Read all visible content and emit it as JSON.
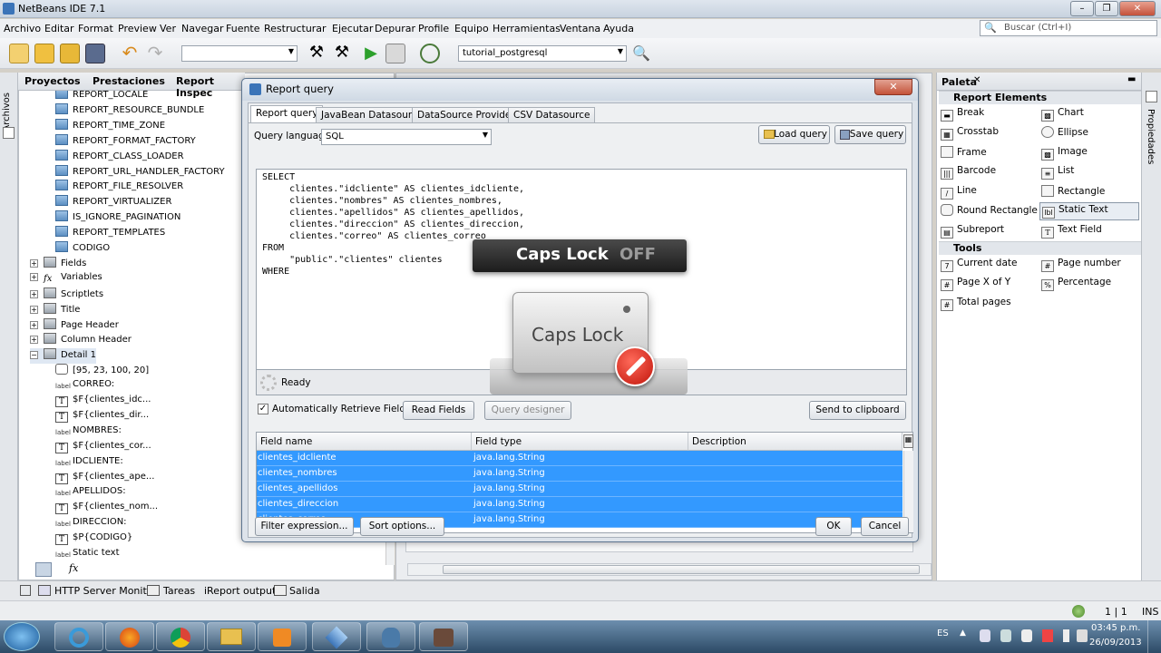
{
  "window": {
    "title": "NetBeans IDE 7.1"
  },
  "menu": [
    "Archivo",
    "Editar",
    "Format",
    "Preview",
    "Ver",
    "Navegar",
    "Fuente",
    "Restructurar",
    "Ejecutar",
    "Depurar",
    "Profile",
    "Equipo",
    "Herramientas",
    "Ventana",
    "Ayuda"
  ],
  "search": {
    "placeholder": "Buscar (Ctrl+I)"
  },
  "toolbar": {
    "project_combo": "tutorial_postgresql"
  },
  "left_tabs": [
    "Proyectos",
    "Prestaciones",
    "Report Inspec"
  ],
  "left_strip_label": "Archivos",
  "tree": [
    {
      "label": "REPORT_LOCALE",
      "icon": "parameter-icon"
    },
    {
      "label": "REPORT_RESOURCE_BUNDLE",
      "icon": "parameter-icon"
    },
    {
      "label": "REPORT_TIME_ZONE",
      "icon": "parameter-icon"
    },
    {
      "label": "REPORT_FORMAT_FACTORY",
      "icon": "parameter-icon"
    },
    {
      "label": "REPORT_CLASS_LOADER",
      "icon": "parameter-icon"
    },
    {
      "label": "REPORT_URL_HANDLER_FACTORY",
      "icon": "parameter-icon"
    },
    {
      "label": "REPORT_FILE_RESOLVER",
      "icon": "parameter-icon"
    },
    {
      "label": "REPORT_VIRTUALIZER",
      "icon": "parameter-icon"
    },
    {
      "label": "IS_IGNORE_PAGINATION",
      "icon": "parameter-icon"
    },
    {
      "label": "REPORT_TEMPLATES",
      "icon": "parameter-icon"
    },
    {
      "label": "CODIGO",
      "icon": "parameter-icon"
    },
    {
      "label": "Fields",
      "icon": "fields-icon"
    },
    {
      "label": "Variables",
      "icon": "variables-icon"
    },
    {
      "label": "Scriptlets",
      "icon": "scriptlets-icon"
    },
    {
      "label": "Title",
      "icon": "band-icon"
    },
    {
      "label": "Page Header",
      "icon": "band-icon"
    },
    {
      "label": "Column Header",
      "icon": "band-icon"
    },
    {
      "label": "Detail 1",
      "icon": "band-icon"
    },
    {
      "label": "[95, 23, 100, 20]",
      "icon": "frame-icon"
    },
    {
      "label": "CORREO:",
      "icon": "label-icon"
    },
    {
      "label": "$F{clientes_idc...",
      "icon": "textfield-icon"
    },
    {
      "label": "$F{clientes_dir...",
      "icon": "textfield-icon"
    },
    {
      "label": "NOMBRES:",
      "icon": "label-icon"
    },
    {
      "label": "$F{clientes_cor...",
      "icon": "textfield-icon"
    },
    {
      "label": "IDCLIENTE:",
      "icon": "label-icon"
    },
    {
      "label": "$F{clientes_ape...",
      "icon": "textfield-icon"
    },
    {
      "label": "APELLIDOS:",
      "icon": "label-icon"
    },
    {
      "label": "$F{clientes_nom...",
      "icon": "textfield-icon"
    },
    {
      "label": "DIRECCION:",
      "icon": "label-icon"
    },
    {
      "label": "$P{CODIGO}",
      "icon": "textfield-icon"
    },
    {
      "label": "Static text",
      "icon": "label-icon"
    }
  ],
  "dialog": {
    "title": "Report query",
    "tabs": [
      "Report query",
      "JavaBean Datasource",
      "DataSource Provider",
      "CSV Datasource"
    ],
    "query_language_label": "Query language",
    "query_language_value": "SQL",
    "load_query": "Load query",
    "save_query": "Save query",
    "sql_lines": [
      "SELECT",
      "     clientes.\"idcliente\" AS clientes_idcliente,",
      "     clientes.\"nombres\" AS clientes_nombres,",
      "     clientes.\"apellidos\" AS clientes_apellidos,",
      "     clientes.\"direccion\" AS clientes_direccion,",
      "     clientes.\"correo\" AS clientes_correo",
      "FROM",
      "     \"public\".\"clientes\" clientes",
      "WHERE"
    ],
    "status": "Ready",
    "auto_retrieve": "Automatically Retrieve Fields",
    "read_fields": "Read Fields",
    "query_designer": "Query designer",
    "send_clipboard": "Send to clipboard",
    "columns": [
      "Field name",
      "Field type",
      "Description"
    ],
    "fields": [
      {
        "name": "clientes_idcliente",
        "type": "java.lang.String",
        "desc": ""
      },
      {
        "name": "clientes_nombres",
        "type": "java.lang.String",
        "desc": ""
      },
      {
        "name": "clientes_apellidos",
        "type": "java.lang.String",
        "desc": ""
      },
      {
        "name": "clientes_direccion",
        "type": "java.lang.String",
        "desc": ""
      },
      {
        "name": "clientes_correo",
        "type": "java.lang.String",
        "desc": ""
      }
    ],
    "filter_expression": "Filter expression...",
    "sort_options": "Sort options...",
    "ok": "OK",
    "cancel": "Cancel"
  },
  "osd": {
    "caps_label": "Caps Lock",
    "caps_state": "OFF",
    "key_label": "Caps Lock"
  },
  "palette": {
    "title": "Paleta",
    "right_strip_label": "Propiedades",
    "sections": [
      {
        "name": "Report Elements",
        "items": [
          "Break",
          "Chart",
          "Crosstab",
          "Ellipse",
          "Frame",
          "Image",
          "Barcode",
          "List",
          "Line",
          "Rectangle",
          "Round Rectangle",
          "Static Text",
          "Subreport",
          "Text Field"
        ]
      },
      {
        "name": "Tools",
        "items": [
          "Current date",
          "Page number",
          "Page X of Y",
          "Percentage",
          "Total pages"
        ]
      }
    ]
  },
  "bottom_tabs": [
    "HTTP Server Monitor",
    "Tareas",
    "iReport output",
    "Salida"
  ],
  "statusbar": {
    "position": "1 | 1",
    "mode": "INS"
  },
  "taskbar": {
    "lang": "ES",
    "time": "03:45 p.m.",
    "date": "26/09/2013"
  }
}
